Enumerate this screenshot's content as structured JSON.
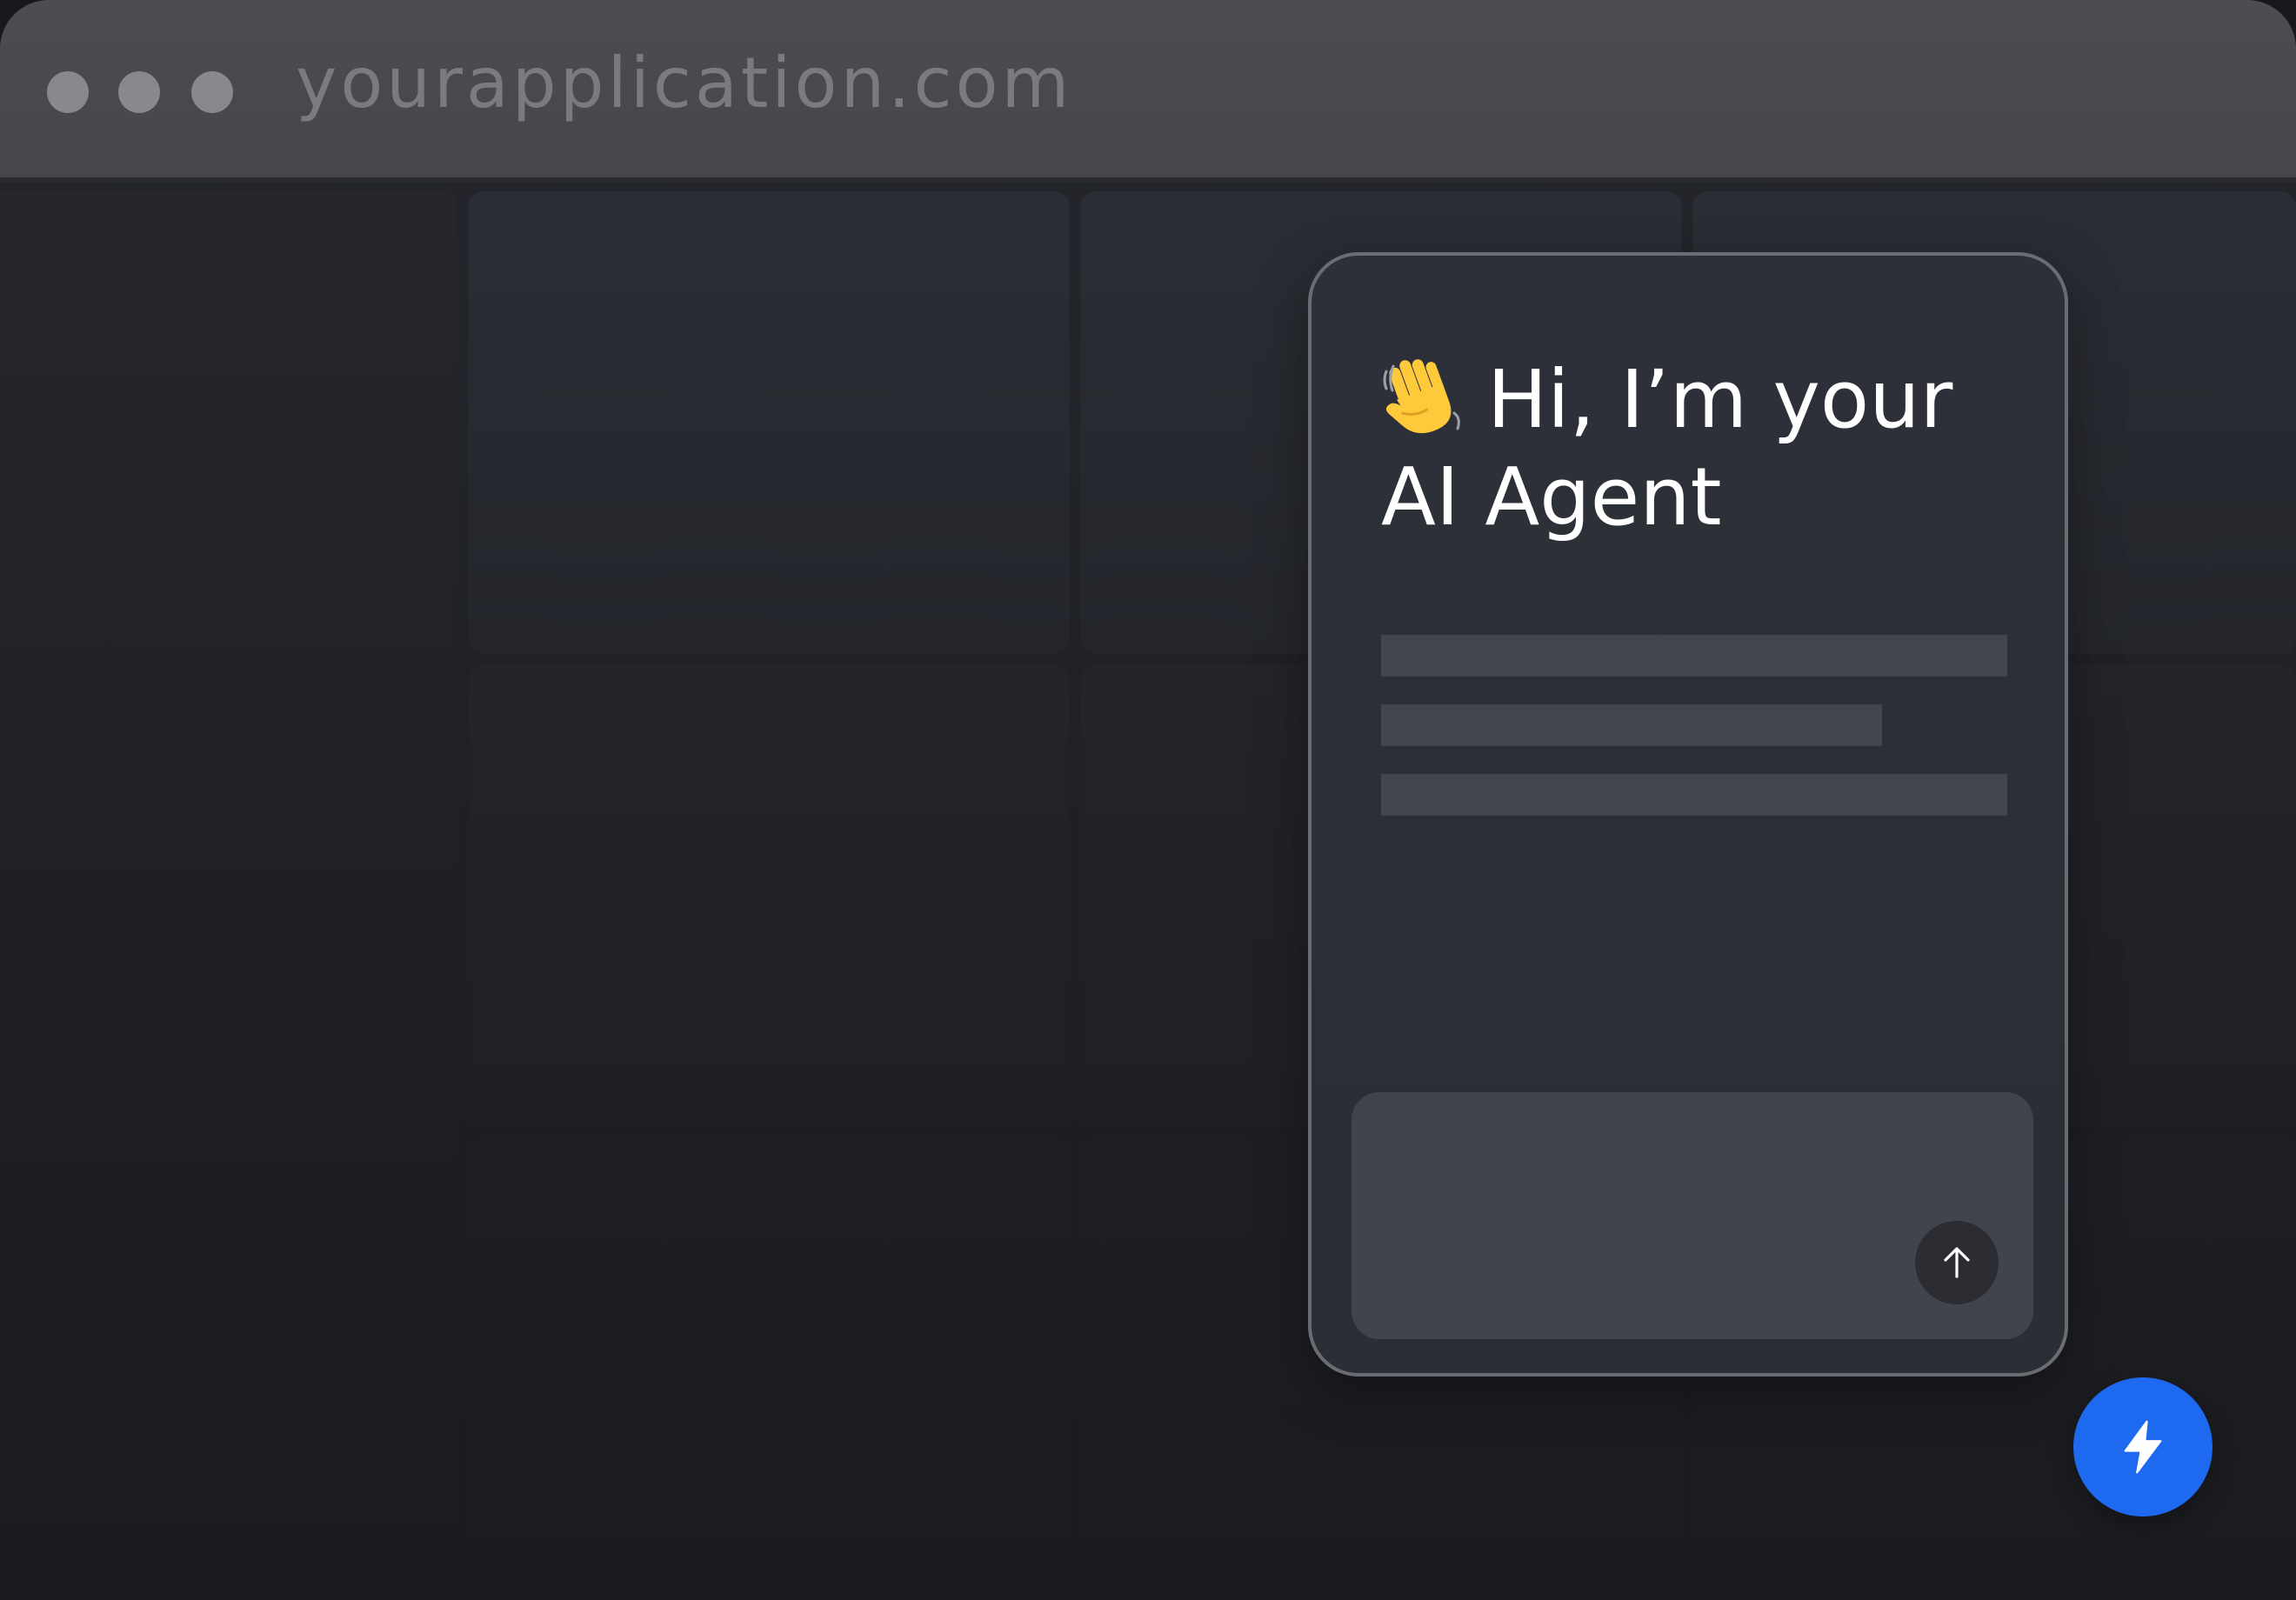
{
  "browser": {
    "url": "yourapplication.com"
  },
  "chat": {
    "greeting_line1": "Hi, I’m your",
    "greeting_line2": "AI Agent",
    "wave_icon": "waving-hand-icon",
    "send_icon": "arrow-up-icon"
  },
  "launcher": {
    "icon": "lightning-bolt-icon",
    "color": "#1d6af0"
  },
  "colors": {
    "accent": "#1d6af0",
    "panel_border": "#6a6c73",
    "panel_bg": "#2d3038"
  }
}
